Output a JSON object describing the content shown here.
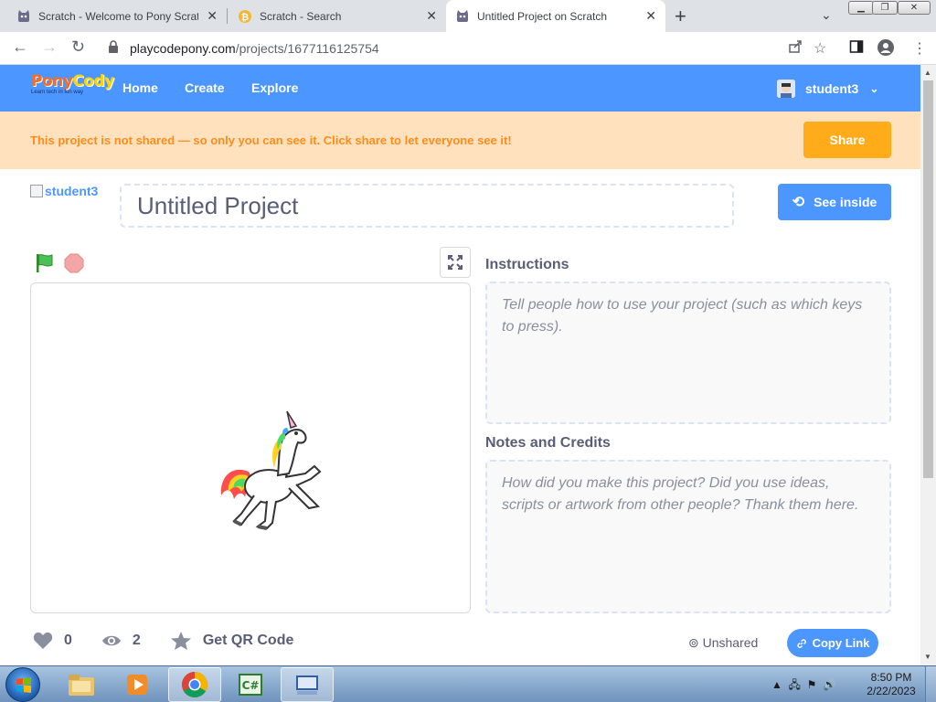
{
  "browser": {
    "tabs": [
      {
        "title": "Scratch - Welcome to Pony Scrat",
        "favicon": "scratch-cat-icon"
      },
      {
        "title": "Scratch - Search",
        "favicon": "bitcoin-coin-icon"
      },
      {
        "title": "Untitled Project on Scratch",
        "favicon": "scratch-cat-icon",
        "active": true
      }
    ],
    "url_host": "playcodepony.com",
    "url_path": "/projects/1677116125754"
  },
  "site": {
    "logo_text_a": "Pony",
    "logo_text_b": "Cody",
    "logo_tagline": "Learn tech in fun way",
    "nav": [
      "Home",
      "Create",
      "Explore"
    ],
    "username": "student3",
    "accent": "#4c97ff"
  },
  "banner": {
    "message": "This project is not shared — so only you can see it. Click share to let everyone see it!",
    "share_label": "Share",
    "color": "#ffab1a"
  },
  "project": {
    "author_alt": "student3",
    "title": "Untitled Project",
    "see_inside_label": "See inside",
    "instructions_label": "Instructions",
    "instructions_placeholder": "Tell people how to use your project (such as which keys to press).",
    "notes_label": "Notes and Credits",
    "notes_placeholder": "How did you make this project? Did you use ideas, scripts or artwork from other people? Thank them here.",
    "loves": "0",
    "views": "2",
    "qr_label": "Get QR Code",
    "share_status": "Unshared",
    "copy_link_label": "Copy Link"
  },
  "taskbar": {
    "time": "8:50 PM",
    "date": "2/22/2023"
  }
}
